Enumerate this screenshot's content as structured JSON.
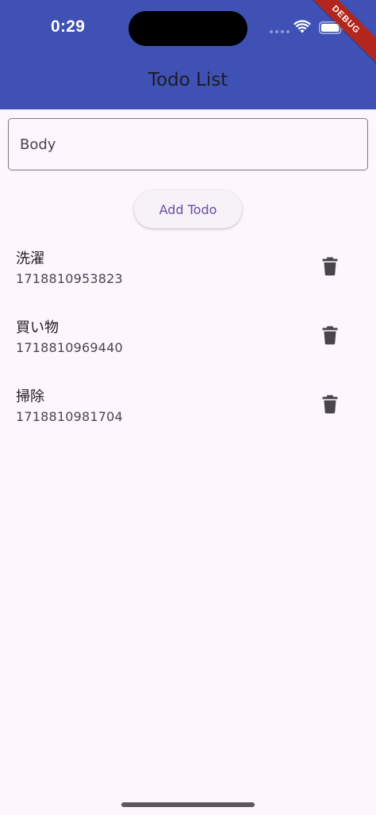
{
  "status_bar": {
    "time": "0:29",
    "icons": [
      "wifi-icon",
      "battery-icon"
    ]
  },
  "debug_banner": "DEBUG",
  "app_bar": {
    "title": "Todo List"
  },
  "form": {
    "body_placeholder": "Body",
    "body_value": "",
    "add_label": "Add Todo"
  },
  "todos": [
    {
      "title": "洗濯",
      "subtitle": "1718810953823",
      "icon": "trash-icon"
    },
    {
      "title": "買い物",
      "subtitle": "1718810969440",
      "icon": "trash-icon"
    },
    {
      "title": "掃除",
      "subtitle": "1718810981704",
      "icon": "trash-icon"
    }
  ],
  "colors": {
    "app_bar": "#3f51b5",
    "background": "#fdf7fd",
    "accent": "#6750a4",
    "icon": "#49454f",
    "debug": "#b3261e"
  }
}
